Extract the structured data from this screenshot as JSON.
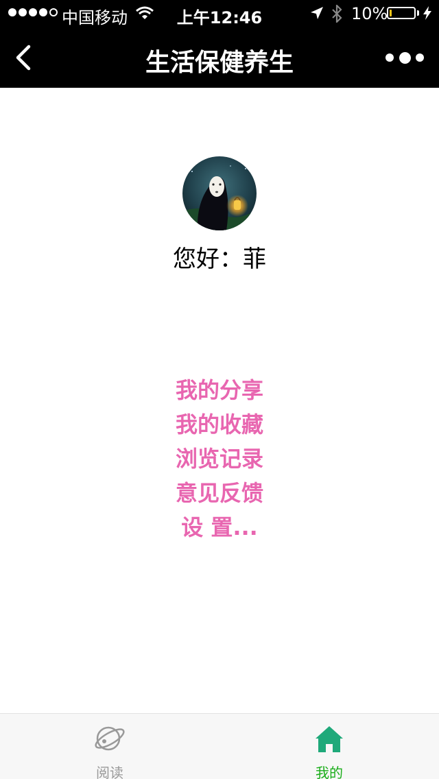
{
  "status_bar": {
    "carrier": "中国移动",
    "time": "上午12:46",
    "battery_percent": "10%",
    "battery_level": 0.1,
    "battery_color": "#f5c518",
    "icons": [
      "signal-dots-icon",
      "wifi-icon",
      "location-arrow-icon",
      "bluetooth-icon",
      "battery-icon",
      "charging-bolt-icon"
    ]
  },
  "navbar": {
    "title": "生活保健养生",
    "back_icon": "chevron-left-icon",
    "more_icon": "more-dots-icon"
  },
  "profile": {
    "avatar_icon": "avatar-image",
    "greeting": "您好：菲"
  },
  "menu": {
    "color": "#e866b0",
    "items": [
      {
        "label": "我的分享"
      },
      {
        "label": "我的收藏"
      },
      {
        "label": "浏览记录"
      },
      {
        "label": "意见反馈"
      },
      {
        "label": "设 置..."
      }
    ]
  },
  "tabbar": {
    "active_color": "#1aad19",
    "inactive_color": "#999999",
    "tabs": [
      {
        "label": "阅读",
        "icon": "planet-icon",
        "active": false
      },
      {
        "label": "我的",
        "icon": "house-icon",
        "active": true
      }
    ]
  }
}
